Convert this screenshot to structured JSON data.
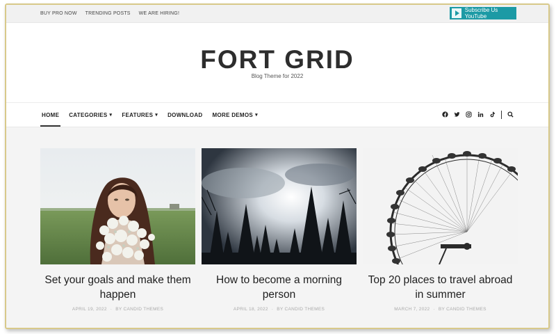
{
  "topbar": {
    "links": [
      "BUY PRO NOW",
      "TRENDING POSTS",
      "WE ARE HIRING!"
    ],
    "youtube_label": "Subscribe Us YouTube"
  },
  "header": {
    "title": "FORT GRID",
    "tagline": "Blog Theme for 2022"
  },
  "nav": {
    "items": [
      {
        "label": "HOME",
        "active": true
      },
      {
        "label": "CATEGORIES",
        "dropdown": true
      },
      {
        "label": "FEATURES",
        "dropdown": true
      },
      {
        "label": "DOWNLOAD"
      },
      {
        "label": "MORE DEMOS",
        "dropdown": true
      }
    ],
    "social": [
      "facebook-icon",
      "twitter-icon",
      "instagram-icon",
      "linkedin-icon",
      "tiktok-icon"
    ],
    "search": "search-icon"
  },
  "posts": [
    {
      "title": "Set your goals and make them happen",
      "date": "APRIL 19, 2022",
      "author": "BY CANDID THEMES"
    },
    {
      "title": "How to become a morning person",
      "date": "APRIL 18, 2022",
      "author": "BY CANDID THEMES"
    },
    {
      "title": "Top 20 places to travel abroad in summer",
      "date": "MARCH 7, 2022",
      "author": "BY CANDID THEMES"
    }
  ]
}
